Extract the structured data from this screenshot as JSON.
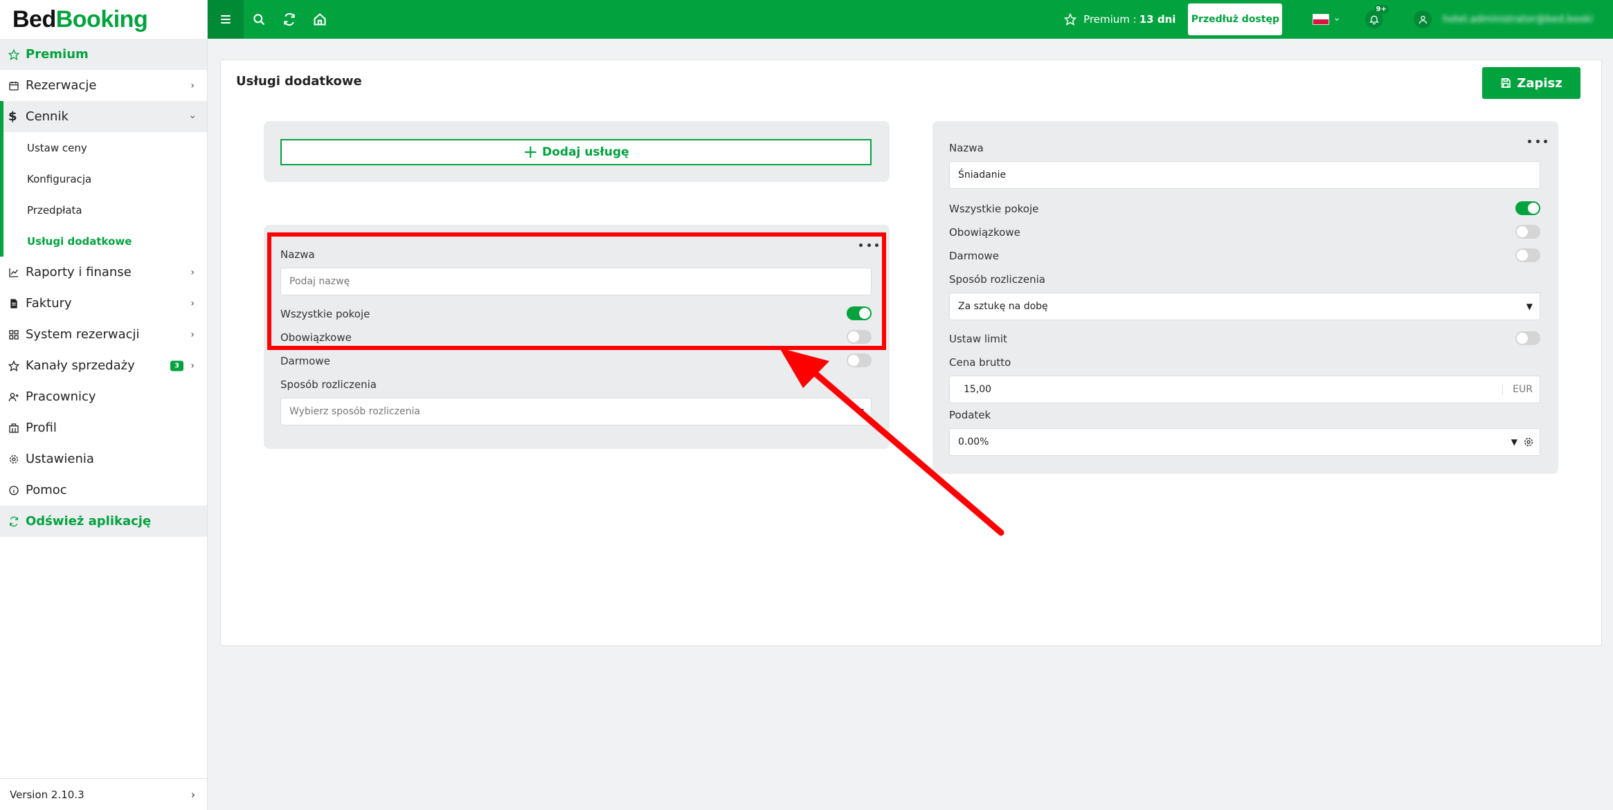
{
  "sidebar": {
    "logo": {
      "part1": "Bed",
      "part2": "Booking"
    },
    "items": [
      {
        "label": "Premium",
        "icon": "star-icon"
      },
      {
        "label": "Rezerwacje",
        "icon": "calendar-icon"
      },
      {
        "label": "Cennik",
        "icon": "dollar-icon"
      },
      {
        "label": "Raporty i finanse",
        "icon": "chart-icon"
      },
      {
        "label": "Faktury",
        "icon": "invoice-icon"
      },
      {
        "label": "System rezerwacji",
        "icon": "grid-icon"
      },
      {
        "label": "Kanały sprzedaży",
        "icon": "star-icon",
        "badge": "3"
      },
      {
        "label": "Pracownicy",
        "icon": "user-plus-icon"
      },
      {
        "label": "Profil",
        "icon": "building-icon"
      },
      {
        "label": "Ustawienia",
        "icon": "gear-icon"
      },
      {
        "label": "Pomoc",
        "icon": "info-icon"
      },
      {
        "label": "Odśwież aplikację",
        "icon": "refresh-icon"
      }
    ],
    "cennik_sub": [
      "Ustaw ceny",
      "Konfiguracja",
      "Przedpłata",
      "Usługi dodatkowe"
    ],
    "version": "Version 2.10.3"
  },
  "topbar": {
    "premium_label": "Premium :",
    "premium_days": "13 dni",
    "extend_label": "Przedłuż dostęp",
    "notif_count": "9+",
    "user_email": "hotel.administrator@bed.booking"
  },
  "main": {
    "title": "Usługi dodatkowe",
    "save_label": "Zapisz",
    "add_service_label": "Dodaj usługę",
    "new_service": {
      "name_label": "Nazwa",
      "name_placeholder": "Podaj nazwę",
      "all_rooms_label": "Wszystkie pokoje",
      "all_rooms": true,
      "mandatory_label": "Obowiązkowe",
      "mandatory": false,
      "free_label": "Darmowe",
      "free": false,
      "billing_label": "Sposób rozliczenia",
      "billing_placeholder": "Wybierz sposób rozliczenia"
    },
    "existing_service": {
      "name_label": "Nazwa",
      "name_value": "Śniadanie",
      "all_rooms_label": "Wszystkie pokoje",
      "all_rooms": true,
      "mandatory_label": "Obowiązkowe",
      "mandatory": false,
      "free_label": "Darmowe",
      "free": false,
      "billing_label": "Sposób rozliczenia",
      "billing_value": "Za sztukę na dobę",
      "limit_label": "Ustaw limit",
      "limit": false,
      "price_label": "Cena brutto",
      "price_value": "15,00",
      "currency": "EUR",
      "tax_label": "Podatek",
      "tax_value": "0.00%"
    }
  },
  "colors": {
    "brand": "#02a23f",
    "annotation": "#ff0000"
  }
}
